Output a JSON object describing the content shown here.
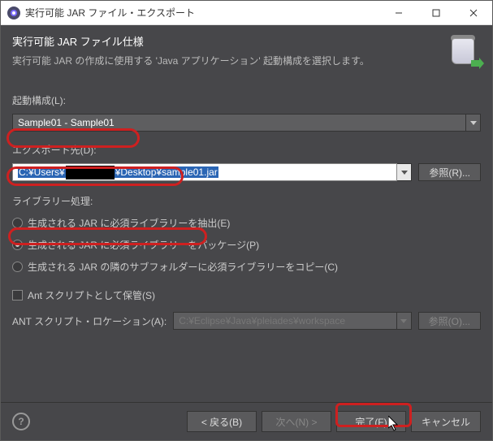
{
  "titlebar": {
    "title": "実行可能 JAR ファイル・エクスポート"
  },
  "banner": {
    "heading": "実行可能 JAR ファイル仕様",
    "description": "実行可能 JAR の作成に使用する 'Java アプリケーション' 起動構成を選択します。"
  },
  "launch_config": {
    "label": "起動構成(L):",
    "value": "Sample01 - Sample01"
  },
  "export_dest": {
    "label": "エクスポート先(D):",
    "value_prefix": "C:¥Users¥",
    "value_censored": "　　　　　",
    "value_suffix": "¥Desktop¥sample01.jar",
    "browse_label": "参照(R)..."
  },
  "library_handling": {
    "label": "ライブラリー処理:",
    "options": [
      {
        "label": "生成される JAR に必須ライブラリーを抽出(E)",
        "selected": false
      },
      {
        "label": "生成される JAR に必須ライブラリーをパッケージ(P)",
        "selected": true
      },
      {
        "label": "生成される JAR の隣のサブフォルダーに必須ライブラリーをコピー(C)",
        "selected": false
      }
    ]
  },
  "ant": {
    "save_label": "Ant スクリプトとして保管(S)",
    "location_label": "ANT スクリプト・ロケーション(A):",
    "location_placeholder": "C:¥Eclipse¥Java¥pleiades¥workspace",
    "browse_label": "参照(O)..."
  },
  "footer": {
    "help": "?",
    "back": "< 戻る(B)",
    "next": "次へ(N) >",
    "finish": "完了(F)",
    "cancel": "キャンセル"
  }
}
